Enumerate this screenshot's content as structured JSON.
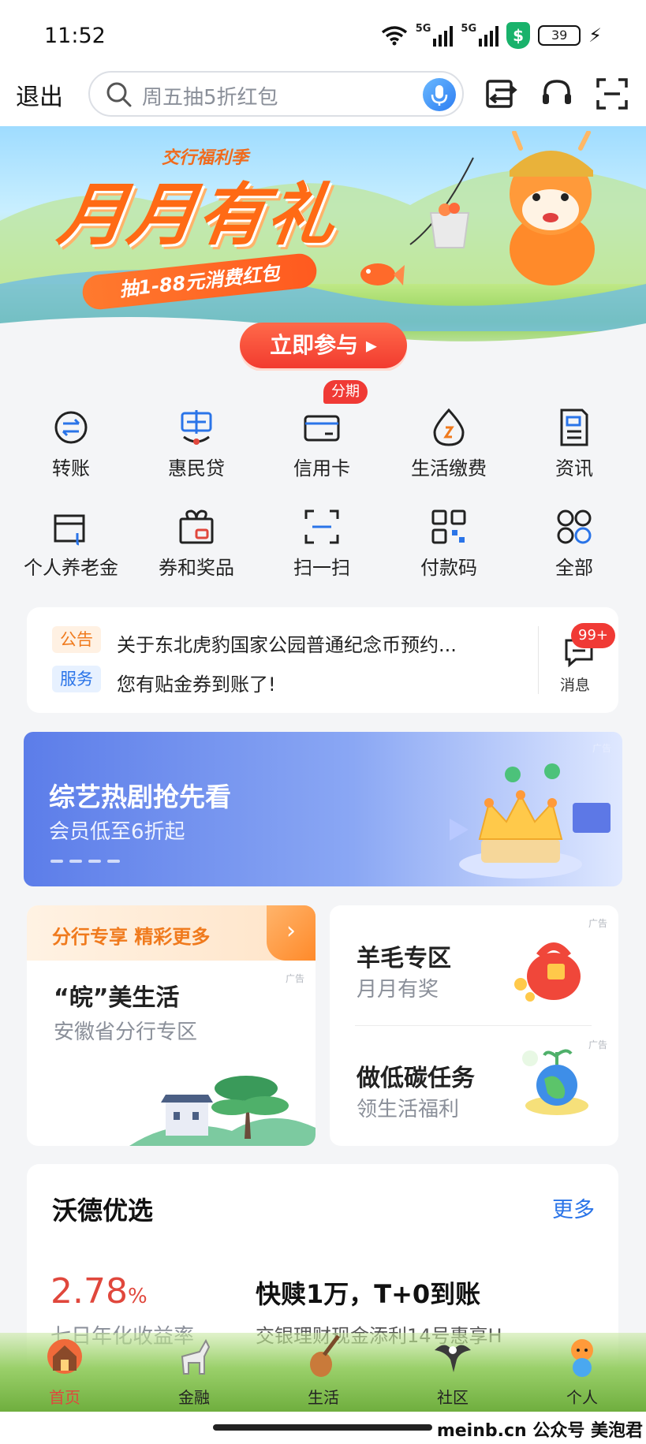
{
  "status_bar": {
    "time": "11:52",
    "network_1": "5G",
    "network_2": "5G",
    "shield": "$",
    "battery": "39"
  },
  "header": {
    "exit_label": "退出",
    "search_placeholder": "周五抽5折红包"
  },
  "banner": {
    "kicker": "交行福利季",
    "title": "月月有礼",
    "subtitle": "抽1-88元消费红包",
    "cta": "立即参与 ▸"
  },
  "quick_menu": {
    "badge": "分期",
    "items": [
      {
        "label": "转账",
        "icon": "transfer-icon"
      },
      {
        "label": "惠民贷",
        "icon": "loan-icon"
      },
      {
        "label": "信用卡",
        "icon": "credit-card-icon"
      },
      {
        "label": "生活缴费",
        "icon": "utility-payment-icon"
      },
      {
        "label": "资讯",
        "icon": "news-icon"
      },
      {
        "label": "个人养老金",
        "icon": "pension-icon"
      },
      {
        "label": "券和奖品",
        "icon": "gift-icon"
      },
      {
        "label": "扫一扫",
        "icon": "scan-icon"
      },
      {
        "label": "付款码",
        "icon": "qr-code-icon"
      },
      {
        "label": "全部",
        "icon": "all-apps-icon"
      }
    ]
  },
  "notices": {
    "items": [
      {
        "tag": "公告",
        "text": "关于东北虎豹国家公园普通纪念币预约..."
      },
      {
        "tag": "服务",
        "text": "您有贴金券到账了!"
      }
    ],
    "messages_label": "消息",
    "messages_badge": "99+"
  },
  "video_ad": {
    "ad_mark": "广告",
    "title": "综艺热剧抢先看",
    "subtitle": "会员低至6折起"
  },
  "branch_card": {
    "header": "分行专享 精彩更多",
    "arrow": "›",
    "ad_mark": "广告",
    "title": "“皖”美生活",
    "subtitle": "安徽省分行专区"
  },
  "promo_card": {
    "items": [
      {
        "title": "羊毛专区",
        "subtitle": "月月有奖",
        "ad_mark": "广告"
      },
      {
        "title": "做低碳任务",
        "subtitle": "领生活福利",
        "ad_mark": "广告"
      }
    ]
  },
  "picks": {
    "title": "沃德优选",
    "more": "更多",
    "product": {
      "rate": "2.78",
      "rate_unit": "%",
      "rate_desc": "七日年化收益率",
      "title": "快赎1万，T+0到账",
      "desc": "交银理财现金添利14号惠享H"
    }
  },
  "bottom_nav": {
    "items": [
      {
        "label": "首页",
        "active": true
      },
      {
        "label": "金融",
        "active": false
      },
      {
        "label": "生活",
        "active": false
      },
      {
        "label": "社区",
        "active": false
      },
      {
        "label": "个人",
        "active": false
      }
    ]
  },
  "footer": {
    "watermark": "meinb.cn  公众号 美泡君"
  },
  "colors": {
    "accent_blue": "#2a74e8",
    "alert_red": "#f03a35",
    "brand_orange": "#ff6a15"
  }
}
